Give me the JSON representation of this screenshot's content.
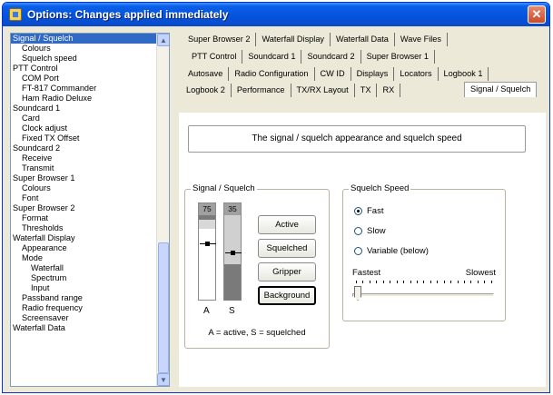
{
  "window": {
    "title": "Options: Changes applied immediately"
  },
  "tree": {
    "items": [
      {
        "label": "Signal / Squelch",
        "level": 0,
        "selected": true
      },
      {
        "label": "Colours",
        "level": 1
      },
      {
        "label": "Squelch speed",
        "level": 1
      },
      {
        "label": "PTT Control",
        "level": 0
      },
      {
        "label": "COM Port",
        "level": 1
      },
      {
        "label": "FT-817 Commander",
        "level": 1
      },
      {
        "label": "Ham Radio Deluxe",
        "level": 1
      },
      {
        "label": "Soundcard 1",
        "level": 0
      },
      {
        "label": "Card",
        "level": 1
      },
      {
        "label": "Clock adjust",
        "level": 1
      },
      {
        "label": "Fixed TX Offset",
        "level": 1
      },
      {
        "label": "Soundcard 2",
        "level": 0
      },
      {
        "label": "Receive",
        "level": 1
      },
      {
        "label": "Transmit",
        "level": 1
      },
      {
        "label": "Super Browser 1",
        "level": 0
      },
      {
        "label": "Colours",
        "level": 1
      },
      {
        "label": "Font",
        "level": 1
      },
      {
        "label": "Super Browser 2",
        "level": 0
      },
      {
        "label": "Format",
        "level": 1
      },
      {
        "label": "Thresholds",
        "level": 1
      },
      {
        "label": "Waterfall Display",
        "level": 0
      },
      {
        "label": "Appearance",
        "level": 1
      },
      {
        "label": "Mode",
        "level": 1
      },
      {
        "label": "Waterfall",
        "level": 2
      },
      {
        "label": "Spectrum",
        "level": 2
      },
      {
        "label": "Input",
        "level": 2
      },
      {
        "label": "Passband range",
        "level": 1
      },
      {
        "label": "Radio frequency",
        "level": 1
      },
      {
        "label": "Screensaver",
        "level": 1
      },
      {
        "label": "Waterfall Data",
        "level": 0
      }
    ]
  },
  "tabs": {
    "row1": [
      "Super Browser 2",
      "Waterfall Display",
      "Waterfall Data",
      "Wave Files"
    ],
    "row2": [
      "PTT Control",
      "Soundcard 1",
      "Soundcard 2",
      "Super Browser 1"
    ],
    "row3": [
      "Autosave",
      "Radio Configuration",
      "CW ID",
      "Displays",
      "Locators",
      "Logbook 1"
    ],
    "row4": [
      "Logbook 2",
      "Performance",
      "TX/RX Layout",
      "TX",
      "RX"
    ],
    "active": "Signal / Squelch"
  },
  "page": {
    "description": "The signal / squelch appearance and squelch speed",
    "signal_group": {
      "label": "Signal / Squelch",
      "meter_a": {
        "value": "75",
        "label": "A"
      },
      "meter_s": {
        "value": "35",
        "label": "S"
      },
      "buttons": {
        "active": "Active",
        "squelched": "Squelched",
        "gripper": "Gripper",
        "background": "Background"
      },
      "legend": "A = active, S = squelched"
    },
    "speed_group": {
      "label": "Squelch Speed",
      "options": [
        "Fast",
        "Slow",
        "Variable (below)"
      ],
      "selected": "Fast",
      "fastest": "Fastest",
      "slowest": "Slowest",
      "slider_position": 0
    }
  },
  "colors": {
    "selection": "#316ac5",
    "title_bar": "#0553dc",
    "meter_gray": "#a0a0a0",
    "meter_dark": "#7a7a7a"
  }
}
